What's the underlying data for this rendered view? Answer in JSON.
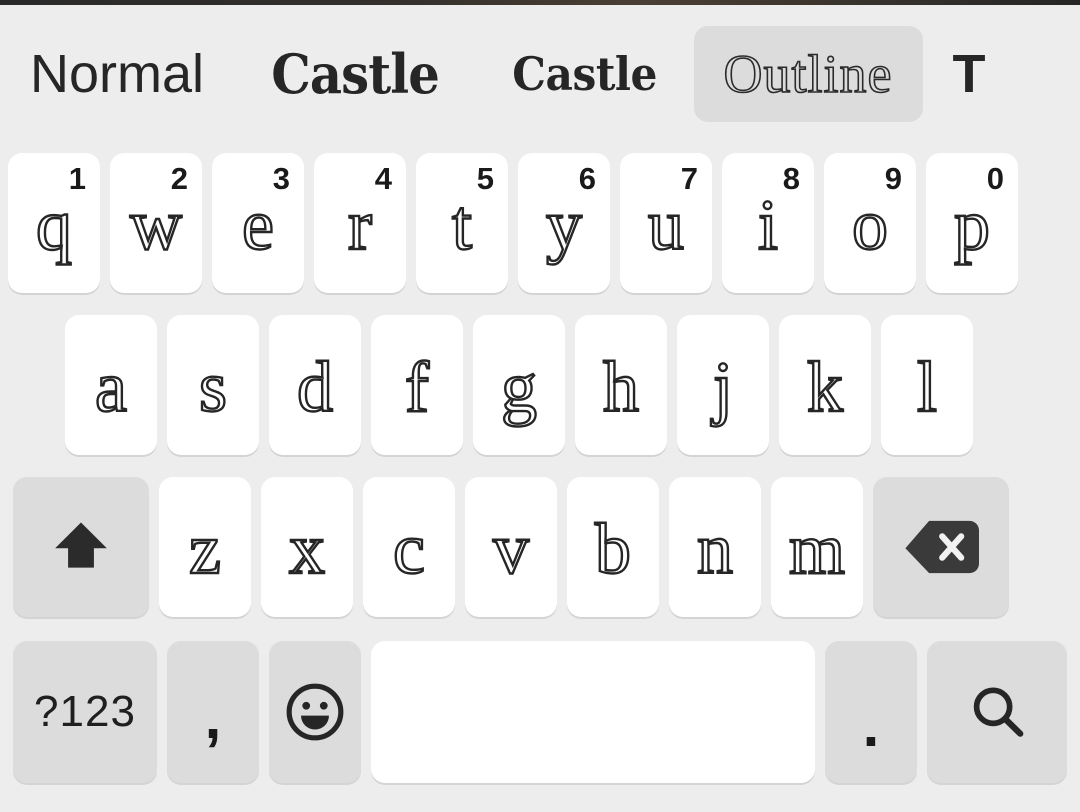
{
  "style_bar": {
    "items": [
      {
        "label": "Normal",
        "style": "normal",
        "selected": false
      },
      {
        "label": "Castle",
        "style": "castle-a",
        "selected": false
      },
      {
        "label": "Castle",
        "style": "castle-b",
        "selected": false
      },
      {
        "label": "Outline",
        "style": "outline",
        "selected": true
      },
      {
        "label": "T",
        "style": "cut",
        "selected": false
      }
    ]
  },
  "keyboard": {
    "row1": [
      {
        "label": "q",
        "hint": "1"
      },
      {
        "label": "w",
        "hint": "2"
      },
      {
        "label": "e",
        "hint": "3"
      },
      {
        "label": "r",
        "hint": "4"
      },
      {
        "label": "t",
        "hint": "5"
      },
      {
        "label": "y",
        "hint": "6"
      },
      {
        "label": "u",
        "hint": "7"
      },
      {
        "label": "i",
        "hint": "8"
      },
      {
        "label": "o",
        "hint": "9"
      },
      {
        "label": "p",
        "hint": "0"
      }
    ],
    "row2": [
      {
        "label": "a"
      },
      {
        "label": "s"
      },
      {
        "label": "d"
      },
      {
        "label": "f"
      },
      {
        "label": "g"
      },
      {
        "label": "h"
      },
      {
        "label": "j"
      },
      {
        "label": "k"
      },
      {
        "label": "l"
      }
    ],
    "row3": {
      "shift": {
        "name": "shift-key",
        "icon": "shift-arrow-icon"
      },
      "letters": [
        {
          "label": "z"
        },
        {
          "label": "x"
        },
        {
          "label": "c"
        },
        {
          "label": "v"
        },
        {
          "label": "b"
        },
        {
          "label": "n"
        },
        {
          "label": "m"
        }
      ],
      "backspace": {
        "name": "backspace-key",
        "icon": "backspace-icon"
      }
    },
    "row4": {
      "symbols_label": "?123",
      "comma_label": ",",
      "emoji_icon": "emoji-smiley-icon",
      "space_label": "",
      "period_label": ".",
      "enter_icon": "search-icon"
    }
  },
  "colors": {
    "background": "#ededed",
    "key_light": "#ffffff",
    "key_dark": "#dcdcdc",
    "glyph": "#262626",
    "selected_chip": "#dcdcdc"
  }
}
